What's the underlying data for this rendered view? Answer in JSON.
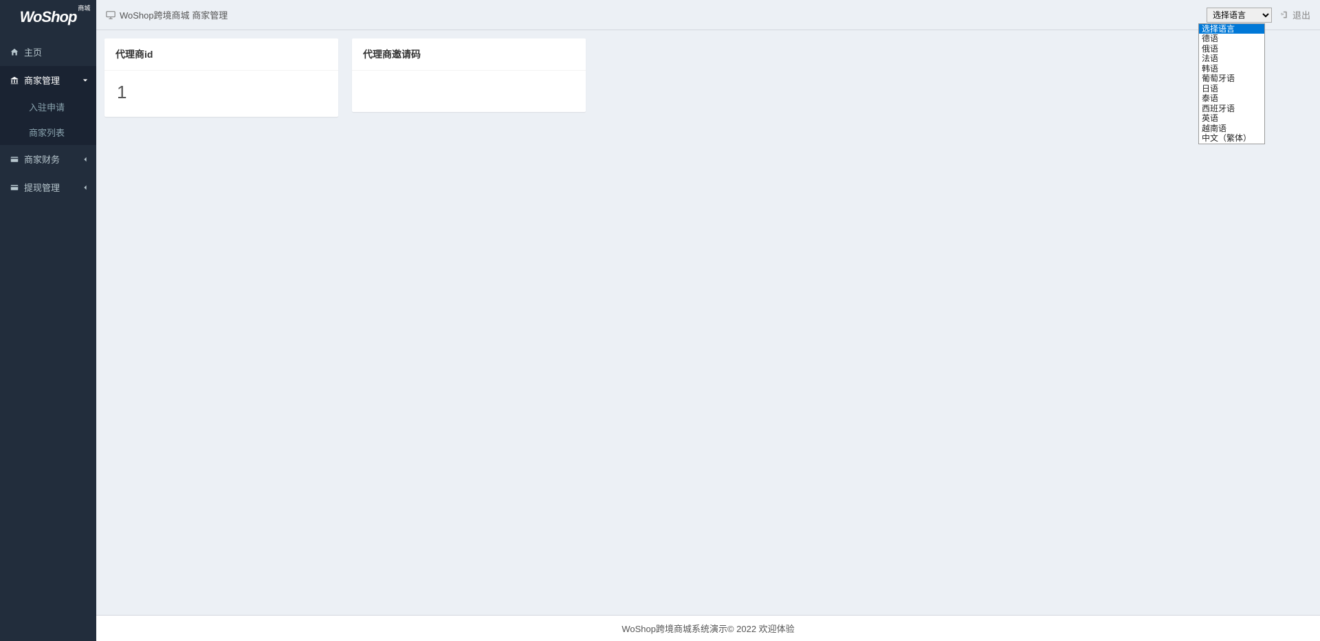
{
  "logo": {
    "main": "WoShop",
    "sup": "商城"
  },
  "sidebar": {
    "items": [
      {
        "icon": "home",
        "label": "主页",
        "active": false,
        "expandable": false
      },
      {
        "icon": "bank",
        "label": "商家管理",
        "active": true,
        "expandable": true,
        "expanded": true,
        "children": [
          {
            "label": "入驻申请"
          },
          {
            "label": "商家列表"
          }
        ]
      },
      {
        "icon": "card",
        "label": "商家财务",
        "active": false,
        "expandable": true
      },
      {
        "icon": "card",
        "label": "提现管理",
        "active": false,
        "expandable": true
      }
    ]
  },
  "header": {
    "title": "WoShop跨境商城 商家管理",
    "logout": "退出",
    "lang_selected": "选择语言",
    "lang_options": [
      "选择语言",
      "德语",
      "俄语",
      "法语",
      "韩语",
      "葡萄牙语",
      "日语",
      "泰语",
      "西班牙语",
      "英语",
      "越南语",
      "中文（繁体）"
    ]
  },
  "cards": [
    {
      "title": "代理商id",
      "value": "1"
    },
    {
      "title": "代理商邀请码",
      "value": ""
    }
  ],
  "footer": "WoShop跨境商城系统演示© 2022 欢迎体验"
}
